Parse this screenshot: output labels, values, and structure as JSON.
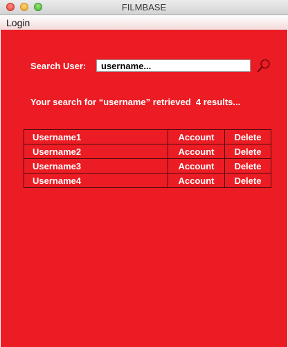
{
  "window": {
    "title": "FILMBASE"
  },
  "menubar": {
    "items": [
      "Login"
    ]
  },
  "search": {
    "label": "Search User:",
    "value": "username..."
  },
  "results": {
    "summary": "Your search for “username” retrieved  4 results...",
    "rows": [
      {
        "username": "Username1",
        "account": "Account",
        "delete": "Delete"
      },
      {
        "username": "Username2",
        "account": "Account",
        "delete": "Delete"
      },
      {
        "username": "Username3",
        "account": "Account",
        "delete": "Delete"
      },
      {
        "username": "Username4",
        "account": "Account",
        "delete": "Delete"
      }
    ]
  },
  "colors": {
    "background": "#ec1c24",
    "text": "#ffffff",
    "grid": "#4a0a0c"
  },
  "icons": {
    "search": "magnifier-icon"
  }
}
